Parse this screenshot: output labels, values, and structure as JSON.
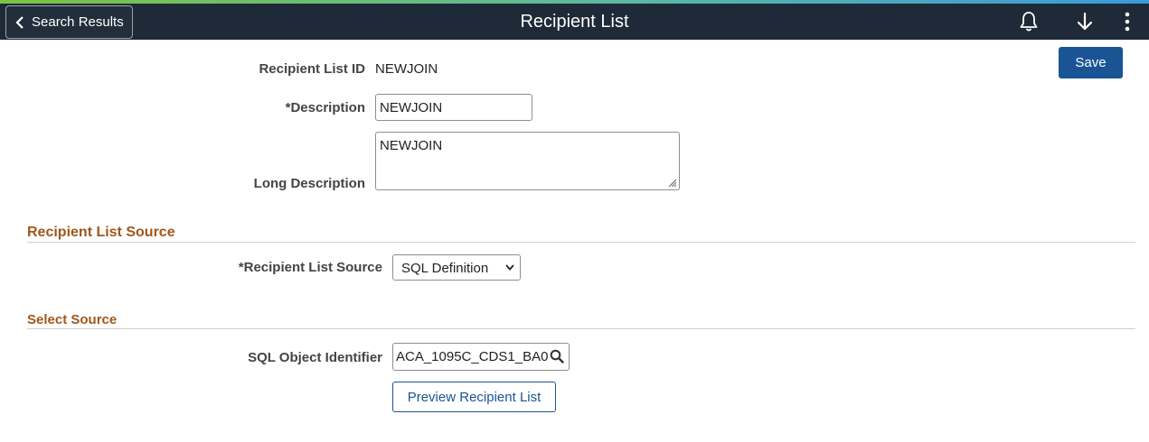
{
  "header": {
    "back_label": "Search Results",
    "title": "Recipient List",
    "icons": [
      "bell-icon",
      "download-arrow-icon",
      "more-vertical-icon"
    ]
  },
  "toolbar": {
    "save_label": "Save"
  },
  "form": {
    "recipient_list_id_label": "Recipient List ID",
    "recipient_list_id_value": "NEWJOIN",
    "description_label": "*Description",
    "description_value": "NEWJOIN",
    "long_description_label": "Long Description",
    "long_description_value": "NEWJOIN"
  },
  "source_section": {
    "title": "Recipient List Source",
    "source_label": "*Recipient List Source",
    "source_selected": "SQL Definition"
  },
  "select_section": {
    "title": "Select Source",
    "sql_label": "SQL Object Identifier",
    "sql_value": "ACA_1095C_CDS1_BA0",
    "preview_label": "Preview Recipient List"
  },
  "colors": {
    "header_bg": "#1e2a38",
    "primary_button": "#1a5495",
    "section_title": "#a0571b"
  }
}
